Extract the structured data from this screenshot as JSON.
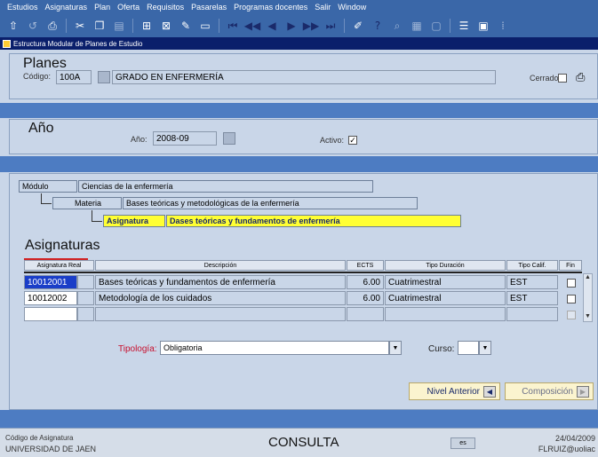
{
  "menu": [
    "Estudios",
    "Asignaturas",
    "Plan",
    "Oferta",
    "Requisitos",
    "Pasarelas",
    "Programas docentes",
    "Salir",
    "Window"
  ],
  "toolbar_icons": [
    "save-icon",
    "undo-icon",
    "print-icon",
    "cut-icon",
    "copy-icon",
    "paste-icon",
    "insert-record-icon",
    "delete-record-icon",
    "query-icon",
    "clear-icon",
    "first-record-icon",
    "previous-set-icon",
    "previous-record-icon",
    "next-record-icon",
    "next-set-icon",
    "last-record-icon",
    "edit-icon",
    "help-icon",
    "search-icon",
    "calendar-icon",
    "window-icon",
    "list-icon",
    "export-icon",
    "grid-icon"
  ],
  "window_title": "Estructura Modular de Planes de Estudio",
  "planes": {
    "title": "Planes",
    "codigo_label": "Código:",
    "codigo": "100A",
    "nombre": "GRADO EN ENFERMERÍA",
    "cerrado_label": "Cerrado:"
  },
  "anio": {
    "title": "Año",
    "anio_label": "Año:",
    "anio": "2008-09",
    "activo_label": "Activo:",
    "activo_check": "✓"
  },
  "hierarchy": {
    "modulo_label": "Módulo",
    "modulo": "Ciencias de la enfermería",
    "materia_label": "Materia",
    "materia": "Bases teóricas y metodológicas de la enfermería",
    "asignatura_label": "Asignatura",
    "asignatura": "Dases teóricas y fundamentos de enfermería"
  },
  "asignaturas": {
    "title": "Asignaturas",
    "columns": [
      "Asignatura Real",
      "Descripción",
      "ECTS",
      "Tipo Duración",
      "Tipo Calif.",
      "Fin"
    ],
    "rows": [
      {
        "codigo": "10012001",
        "descripcion": "Bases teóricas y fundamentos de enfermería",
        "ects": "6.00",
        "duracion": "Cuatrimestral",
        "calif": "EST"
      },
      {
        "codigo": "10012002",
        "descripcion": "Metodología de los cuidados",
        "ects": "6.00",
        "duracion": "Cuatrimestral",
        "calif": "EST"
      }
    ]
  },
  "tipologia": {
    "label": "Tipología:",
    "value": "Obligatoria"
  },
  "curso": {
    "label": "Curso:",
    "value": ""
  },
  "buttons": {
    "nivel_anterior": "Nivel Anterior",
    "composicion": "Composición"
  },
  "status": {
    "field_hint": "Código de Asignatura",
    "org": "UNIVERSIDAD DE JAEN",
    "mode": "CONSULTA",
    "indicator": "es",
    "date": "24/04/2009",
    "user": "FLRUIZ@uoliac"
  },
  "colors": {
    "accent": "#3a67a8",
    "title_bar": "#0a1f6b",
    "highlight": "#ffff33",
    "selected_cell": "#1a3ec8"
  }
}
